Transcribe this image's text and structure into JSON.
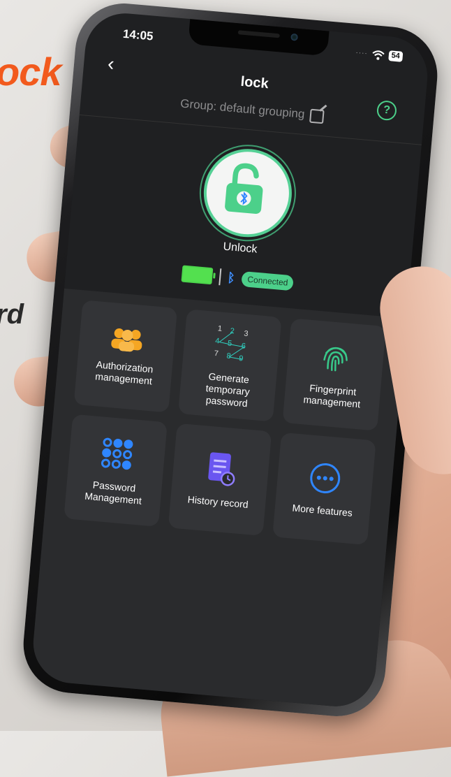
{
  "promo": {
    "title_fragment": "ock",
    "word_fragment": "rd"
  },
  "status_bar": {
    "time": "14:05",
    "signal_dots": "····",
    "battery_level": "54"
  },
  "nav": {
    "back_glyph": "‹",
    "title": "lock",
    "help_glyph": "?"
  },
  "group": {
    "label": "Group: default grouping"
  },
  "unlock": {
    "label": "Unlock"
  },
  "connection": {
    "status": "Connected"
  },
  "features": [
    {
      "label": "Authorization management",
      "icon": "users-icon",
      "color": "#f5a623"
    },
    {
      "label": "Generate temporary password",
      "icon": "keypad-pattern-icon",
      "color": "#2fd0c0"
    },
    {
      "label": "Fingerprint management",
      "icon": "fingerprint-icon",
      "color": "#38c98a"
    },
    {
      "label": "Password Management",
      "icon": "dots-grid-icon",
      "color": "#2f86ff"
    },
    {
      "label": "History record",
      "icon": "document-clock-icon",
      "color": "#6a56f0"
    },
    {
      "label": "More features",
      "icon": "more-icon",
      "color": "#2f86ff"
    }
  ],
  "keypad_digits": [
    "1",
    "2",
    "3",
    "4",
    "5",
    "6",
    "7",
    "8",
    "9"
  ],
  "colors": {
    "accent_green": "#4cd08a",
    "background": "#1f2022",
    "tile": "#333437"
  }
}
